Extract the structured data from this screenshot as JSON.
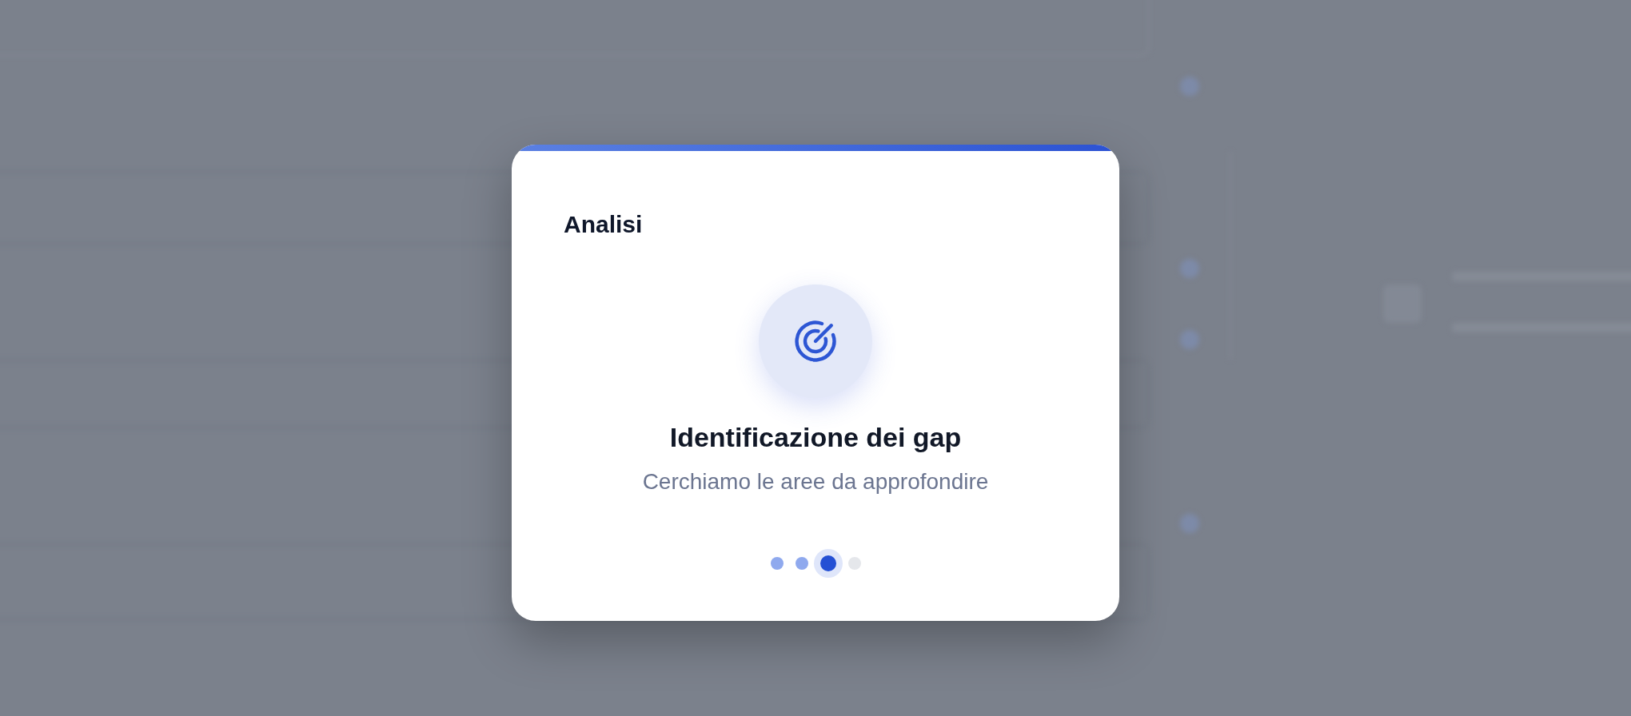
{
  "dialog": {
    "title": "Analisi",
    "heading": "Identificazione dei gap",
    "description": "Cerchiamo le aree da approfondire",
    "steps": [
      {
        "completed": true,
        "selected": false
      },
      {
        "completed": true,
        "selected": false
      },
      {
        "completed": false,
        "selected": true
      },
      {
        "completed": false,
        "selected": false
      }
    ]
  }
}
